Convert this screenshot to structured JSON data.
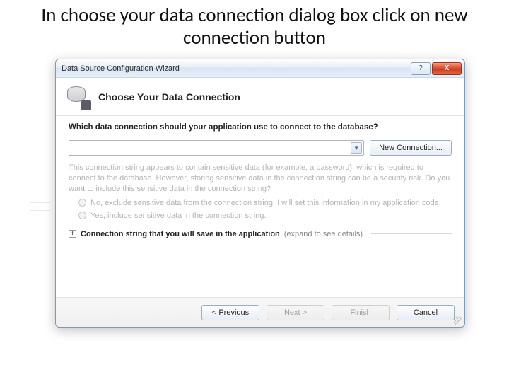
{
  "slide": {
    "title": "In choose your data connection dialog box click on new connection button"
  },
  "dialog": {
    "title": "Data Source Configuration Wizard",
    "header_title": "Choose Your Data Connection",
    "question": "Which data connection should your application use to connect to the database?",
    "new_connection_label": "New Connection...",
    "sensitive_text": "This connection string appears to contain sensitive data (for example, a password), which is required to connect to the database. However, storing sensitive data in the connection string can be a security risk. Do you want to include this sensitive data in the connection string?",
    "radio_no": "No, exclude sensitive data from the connection string. I will set this information in my application code.",
    "radio_yes": "Yes, include sensitive data in the connection string.",
    "expander_bold": "Connection string that you will save in the application",
    "expander_hint": "(expand to see details)",
    "buttons": {
      "previous": "< Previous",
      "next": "Next >",
      "finish": "Finish",
      "cancel": "Cancel"
    },
    "titlebar_icons": {
      "help": "?",
      "close": "X"
    }
  }
}
